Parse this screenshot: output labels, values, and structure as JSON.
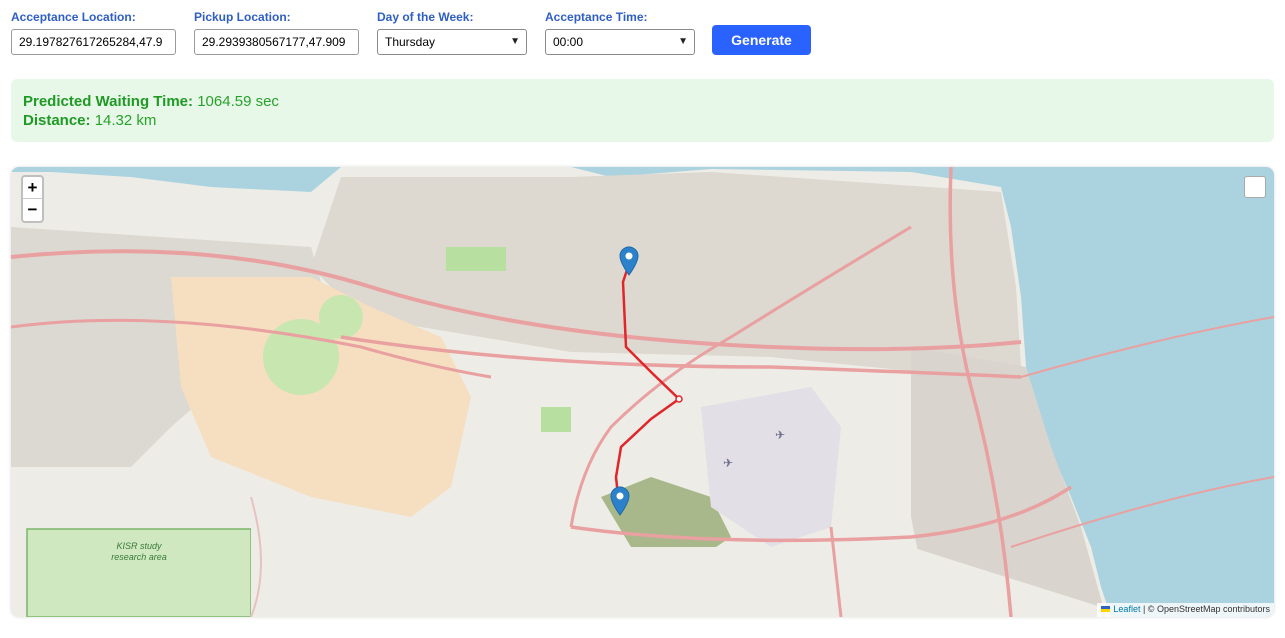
{
  "form": {
    "acceptance_location": {
      "label": "Acceptance Location:",
      "value": "29.197827617265284,47.9"
    },
    "pickup_location": {
      "label": "Pickup Location:",
      "value": "29.2939380567177,47.909"
    },
    "day_of_week": {
      "label": "Day of the Week:",
      "selected": "Thursday"
    },
    "acceptance_time": {
      "label": "Acceptance Time:",
      "selected": "00:00"
    },
    "generate_label": "Generate"
  },
  "result": {
    "waiting_label": "Predicted Waiting Time:",
    "waiting_value": "1064.59 sec",
    "distance_label": "Distance:",
    "distance_value": "14.32 km"
  },
  "map": {
    "zoom_in": "+",
    "zoom_out": "−",
    "attribution_link": "Leaflet",
    "attribution_text": "| © OpenStreetMap contributors",
    "kisr_label": "KISR study research area",
    "route_color": "#e0262a",
    "marker_color": "#2b82cb",
    "sea_color": "#aad3df"
  }
}
